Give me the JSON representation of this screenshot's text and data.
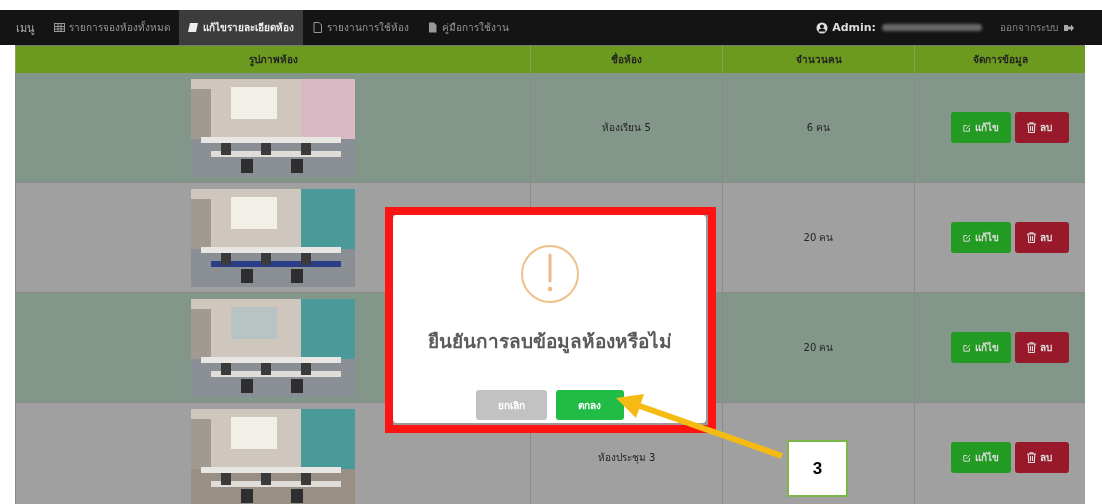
{
  "navbar": {
    "brand": "เมนู",
    "items": [
      {
        "label": "รายการจองห้องทั้งหมด",
        "selected": false
      },
      {
        "label": "แก้ไขรายละเอียดห้อง",
        "selected": true
      },
      {
        "label": "รายงานการใช้ห้อง",
        "selected": false
      },
      {
        "label": "คู่มือการใช้งาน",
        "selected": false
      }
    ],
    "user_label": "Admin:",
    "logout": "ออกจากระบบ"
  },
  "table": {
    "columns": [
      "รูปภาพห้อง",
      "ชื่อห้อง",
      "จำนวนคน",
      "จัดการข้อมูล"
    ],
    "rows": [
      {
        "name": "ห้องเรียน 5",
        "capacity": "6 คน",
        "edit": "แก้ไข",
        "delete": "ลบ"
      },
      {
        "capacity": "20 คน",
        "edit": "แก้ไข",
        "delete": "ลบ"
      },
      {
        "capacity": "20 คน",
        "edit": "แก้ไข",
        "delete": "ลบ"
      },
      {
        "name": "ห้องประชุม 3",
        "edit": "แก้ไข",
        "delete": "ลบ"
      }
    ]
  },
  "dialog": {
    "title": "ยืนยันการลบข้อมูลห้องหรือไม่",
    "cancel": "ยกเลิก",
    "confirm": "ตกลง"
  },
  "annotation": {
    "label": "3"
  }
}
